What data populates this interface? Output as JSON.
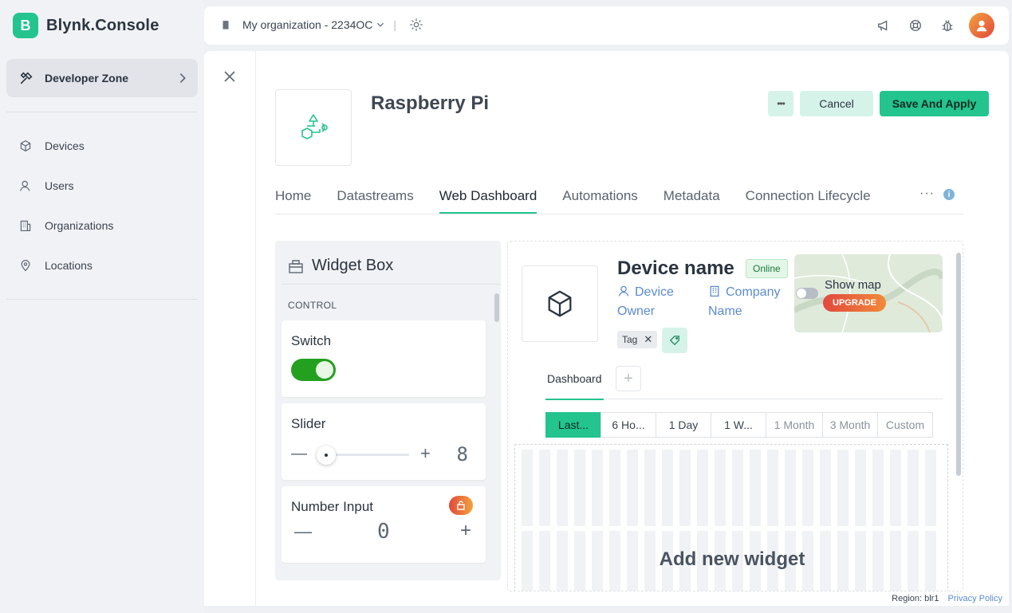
{
  "brand": {
    "logo_letter": "B",
    "name": "Blynk.Console"
  },
  "sidebar": {
    "developer_zone": "Developer Zone",
    "items": [
      {
        "label": "Devices",
        "icon": "cube-icon"
      },
      {
        "label": "Users",
        "icon": "user-icon"
      },
      {
        "label": "Organizations",
        "icon": "building-icon"
      },
      {
        "label": "Locations",
        "icon": "location-pin-icon"
      }
    ]
  },
  "topbar": {
    "organization": "My organization - 2234OC",
    "separator": "|",
    "icons": [
      "megaphone-icon",
      "lifebuoy-icon",
      "bug-icon",
      "avatar"
    ]
  },
  "template": {
    "title": "Raspberry Pi",
    "actions": {
      "more": "•••",
      "cancel": "Cancel",
      "save": "Save And Apply"
    },
    "tabs": [
      "Home",
      "Datastreams",
      "Web Dashboard",
      "Automations",
      "Metadata",
      "Connection Lifecycle"
    ],
    "active_tab": "Web Dashboard",
    "tab_more": "···",
    "tab_info": "i"
  },
  "widget_box": {
    "title": "Widget Box",
    "section": "CONTROL",
    "switch": {
      "name": "Switch"
    },
    "slider": {
      "name": "Slider",
      "minus": "—",
      "plus": "+",
      "value": "8"
    },
    "number_input": {
      "name": "Number Input",
      "minus": "—",
      "plus": "+",
      "value": "0"
    }
  },
  "dashboard": {
    "device_name": "Device name",
    "status": "Online",
    "device_owner": "Device Owner",
    "company_name": "Company Name",
    "tag": "Tag",
    "tag_close": "✕",
    "map": {
      "label": "Show map",
      "upgrade": "UPGRADE"
    },
    "tabs": {
      "active": "Dashboard",
      "add": "+"
    },
    "ranges": [
      "Last...",
      "6 Ho...",
      "1 Day",
      "1 W...",
      "1 Month",
      "3 Month",
      "Custom"
    ],
    "add_widget": "Add new widget"
  },
  "footer": {
    "region": "Region: blr1",
    "privacy": "Privacy Policy"
  },
  "colors": {
    "accent": "#23c48e",
    "switch_on": "#23a020",
    "link": "#5b8bd0"
  }
}
